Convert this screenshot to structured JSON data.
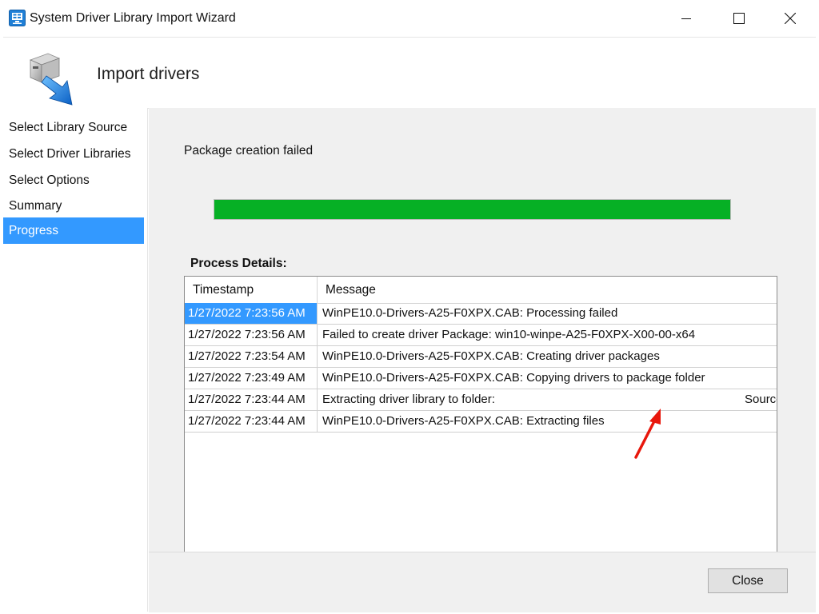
{
  "window": {
    "title": "System Driver Library Import Wizard"
  },
  "header": {
    "title": "Import drivers"
  },
  "nav": {
    "items": [
      {
        "label": "Select Library Source"
      },
      {
        "label": "Select Driver Libraries"
      },
      {
        "label": "Select Options"
      },
      {
        "label": "Summary"
      },
      {
        "label": "Progress",
        "active": true
      }
    ]
  },
  "main": {
    "status": "Package creation failed",
    "progress_fraction": 1.0,
    "progress_color": "#06b025",
    "details_label": "Process Details:",
    "columns": {
      "timestamp": "Timestamp",
      "message": "Message"
    },
    "rows": [
      {
        "timestamp": "1/27/2022 7:23:56 AM",
        "message": "WinPE10.0-Drivers-A25-F0XPX.CAB: Processing failed"
      },
      {
        "timestamp": "1/27/2022 7:23:56 AM",
        "message": "Failed to create driver Package: win10-winpe-A25-F0XPX-X00-00-x64"
      },
      {
        "timestamp": "1/27/2022 7:23:54 AM",
        "message": "WinPE10.0-Drivers-A25-F0XPX.CAB: Creating driver packages"
      },
      {
        "timestamp": "1/27/2022 7:23:49 AM",
        "message": "WinPE10.0-Drivers-A25-F0XPX.CAB: Copying drivers to package folder"
      },
      {
        "timestamp": "1/27/2022 7:23:44 AM",
        "message": "Extracting driver library to folder:",
        "path_tail": "Sources$\\Drivers_Package\\O"
      },
      {
        "timestamp": "1/27/2022 7:23:44 AM",
        "message": "WinPE10.0-Drivers-A25-F0XPX.CAB: Extracting files"
      }
    ]
  },
  "footer": {
    "close_label": "Close"
  },
  "colors": {
    "selection": "#3399ff",
    "annotation_arrow": "#e8170c"
  },
  "icons": {
    "app": "wizard-app-icon",
    "header": "driver-import-icon",
    "minimize": "minimize-icon",
    "maximize": "maximize-icon",
    "close": "close-icon",
    "annotation": "red-arrow-icon"
  }
}
